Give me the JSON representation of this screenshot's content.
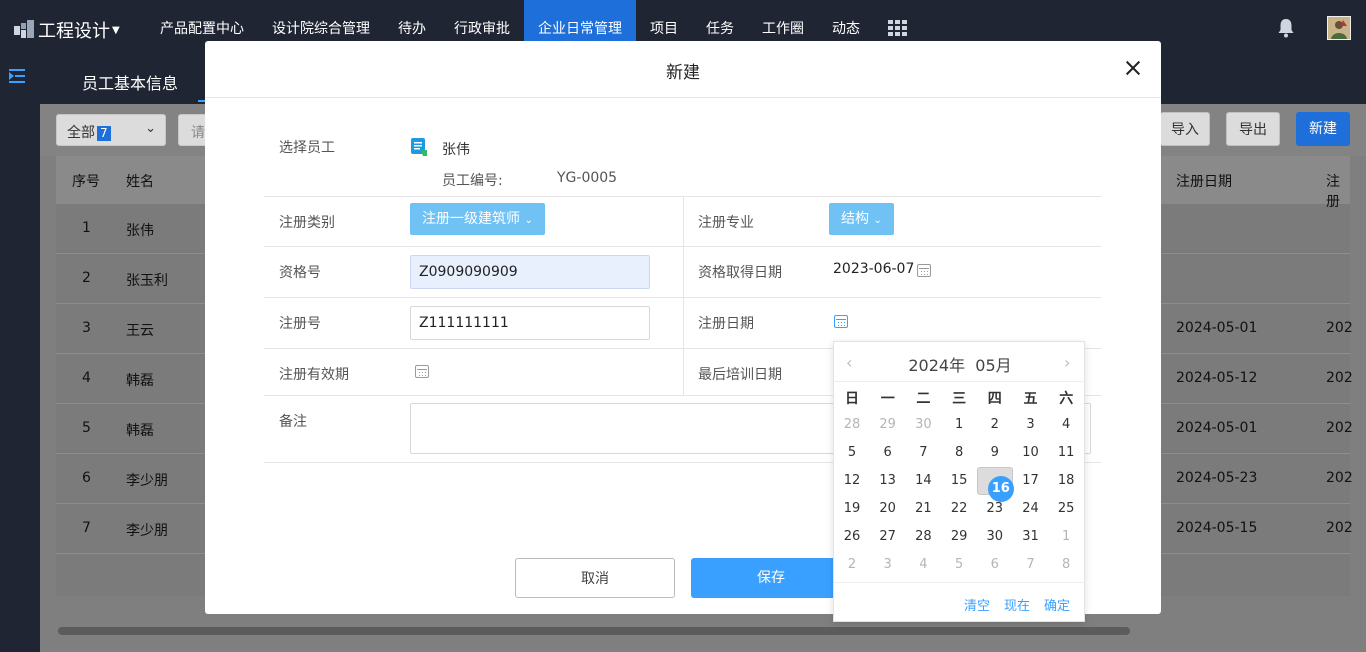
{
  "topnav": {
    "app_title": "工程设计",
    "items": [
      "产品配置中心",
      "设计院综合管理",
      "待办",
      "行政审批",
      "企业日常管理",
      "项目",
      "任务",
      "工作圈",
      "动态"
    ],
    "active_index": 4
  },
  "subtab": {
    "label": "员工基本信息"
  },
  "toolbar": {
    "filter_label": "全部",
    "filter_count": "7",
    "search_placeholder": "请",
    "import_label": "导入",
    "export_label": "导出",
    "new_label": "新建"
  },
  "table": {
    "headers": {
      "index": "序号",
      "name": "姓名",
      "reg_date": "注册日期",
      "next": "注册"
    },
    "rows": [
      {
        "index": "1",
        "name": "张伟",
        "reg_date": "",
        "next": ""
      },
      {
        "index": "2",
        "name": "张玉利",
        "reg_date": "",
        "next": ""
      },
      {
        "index": "3",
        "name": "王云",
        "reg_date": "2024-05-01",
        "next": "202"
      },
      {
        "index": "4",
        "name": "韩磊",
        "reg_date": "2024-05-12",
        "next": "202"
      },
      {
        "index": "5",
        "name": "韩磊",
        "reg_date": "2024-05-01",
        "next": "202"
      },
      {
        "index": "6",
        "name": "李少朋",
        "reg_date": "2024-05-23",
        "next": "202"
      },
      {
        "index": "7",
        "name": "李少朋",
        "reg_date": "2024-05-15",
        "next": "202"
      }
    ]
  },
  "modal": {
    "title": "新建",
    "select_employee_label": "选择员工",
    "employee_name": "张伟",
    "employee_no_label": "员工编号:",
    "employee_no": "YG-0005",
    "reg_category_label": "注册类别",
    "reg_category_value": "注册一级建筑师",
    "reg_major_label": "注册专业",
    "reg_major_value": "结构",
    "qual_no_label": "资格号",
    "qual_no_value": "Z0909090909",
    "qual_date_label": "资格取得日期",
    "qual_date_value": "2023-06-07",
    "reg_no_label": "注册号",
    "reg_no_value": "Z111111111",
    "reg_date_label": "注册日期",
    "reg_valid_label": "注册有效期",
    "last_training_label": "最后培训日期",
    "remark_label": "备注",
    "cancel_label": "取消",
    "save_label": "保存"
  },
  "datepicker": {
    "year": "2024年",
    "month": "05月",
    "weekdays": [
      "日",
      "一",
      "二",
      "三",
      "四",
      "五",
      "六"
    ],
    "weeks": [
      [
        "28",
        "29",
        "30",
        "1",
        "2",
        "3",
        "4"
      ],
      [
        "5",
        "6",
        "7",
        "8",
        "9",
        "10",
        "11"
      ],
      [
        "12",
        "13",
        "14",
        "15",
        "16",
        "17",
        "18"
      ],
      [
        "19",
        "20",
        "21",
        "22",
        "23",
        "24",
        "25"
      ],
      [
        "26",
        "27",
        "28",
        "29",
        "30",
        "31",
        "1"
      ],
      [
        "2",
        "3",
        "4",
        "5",
        "6",
        "7",
        "8"
      ]
    ],
    "selected": "16",
    "clear_label": "清空",
    "now_label": "现在",
    "confirm_label": "确定"
  }
}
